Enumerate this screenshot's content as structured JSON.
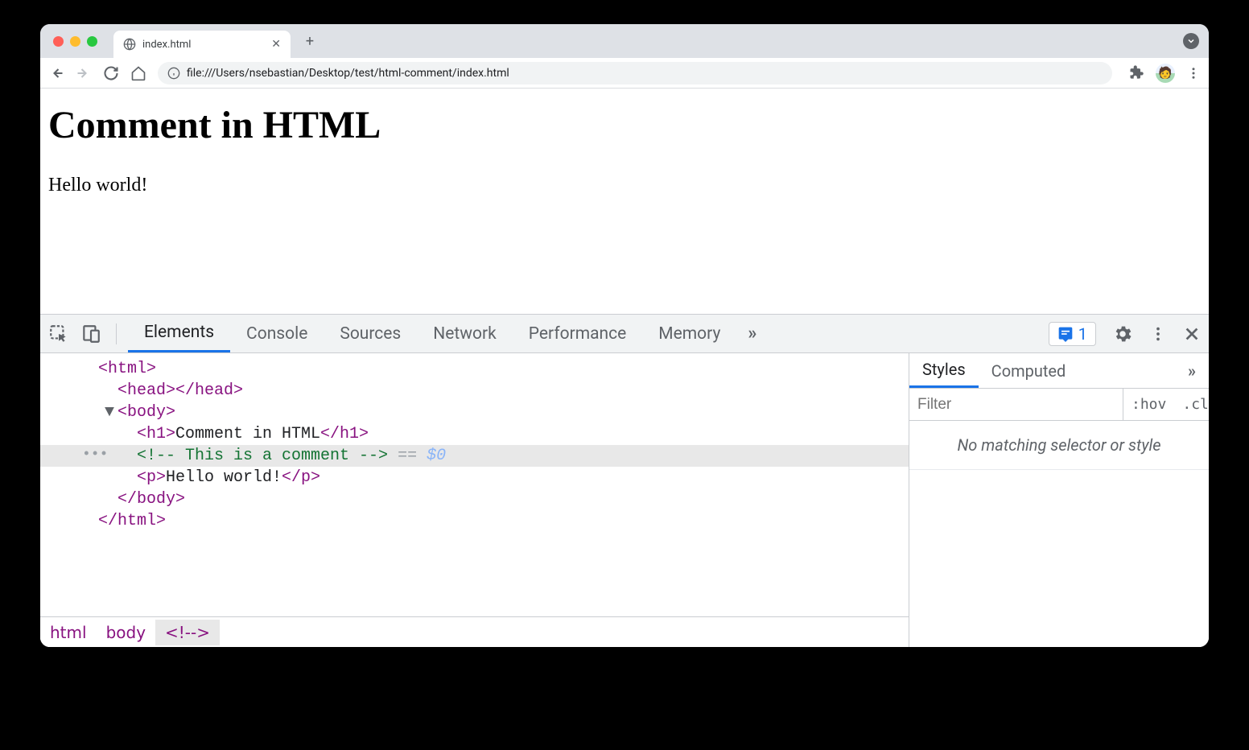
{
  "window": {
    "tab_title": "index.html",
    "new_tab_label": "+",
    "expand_label": "⌄"
  },
  "toolbar": {
    "url": "file:///Users/nsebastian/Desktop/test/html-comment/index.html"
  },
  "page": {
    "heading": "Comment in HTML",
    "paragraph": "Hello world!"
  },
  "devtools": {
    "tabs": [
      "Elements",
      "Console",
      "Sources",
      "Network",
      "Performance",
      "Memory"
    ],
    "more_label": "»",
    "issues_count": "1",
    "dom": {
      "html_open": "<html>",
      "head": "<head></head>",
      "body_open": "<body>",
      "h1_open": "<h1>",
      "h1_text": "Comment in HTML",
      "h1_close": "</h1>",
      "comment": "<!-- This is a comment -->",
      "eq": " == ",
      "var": "$0",
      "p_open": "<p>",
      "p_text": "Hello world!",
      "p_close": "</p>",
      "body_close": "</body>",
      "html_close": "</html>"
    },
    "breadcrumbs": [
      "html",
      "body",
      "<!--​>"
    ],
    "styles": {
      "tabs": [
        "Styles",
        "Computed"
      ],
      "more_label": "»",
      "filter_placeholder": "Filter",
      "hov_label": ":hov",
      "cls_label": ".cls",
      "plus_label": "+",
      "no_match": "No matching selector or style"
    }
  }
}
